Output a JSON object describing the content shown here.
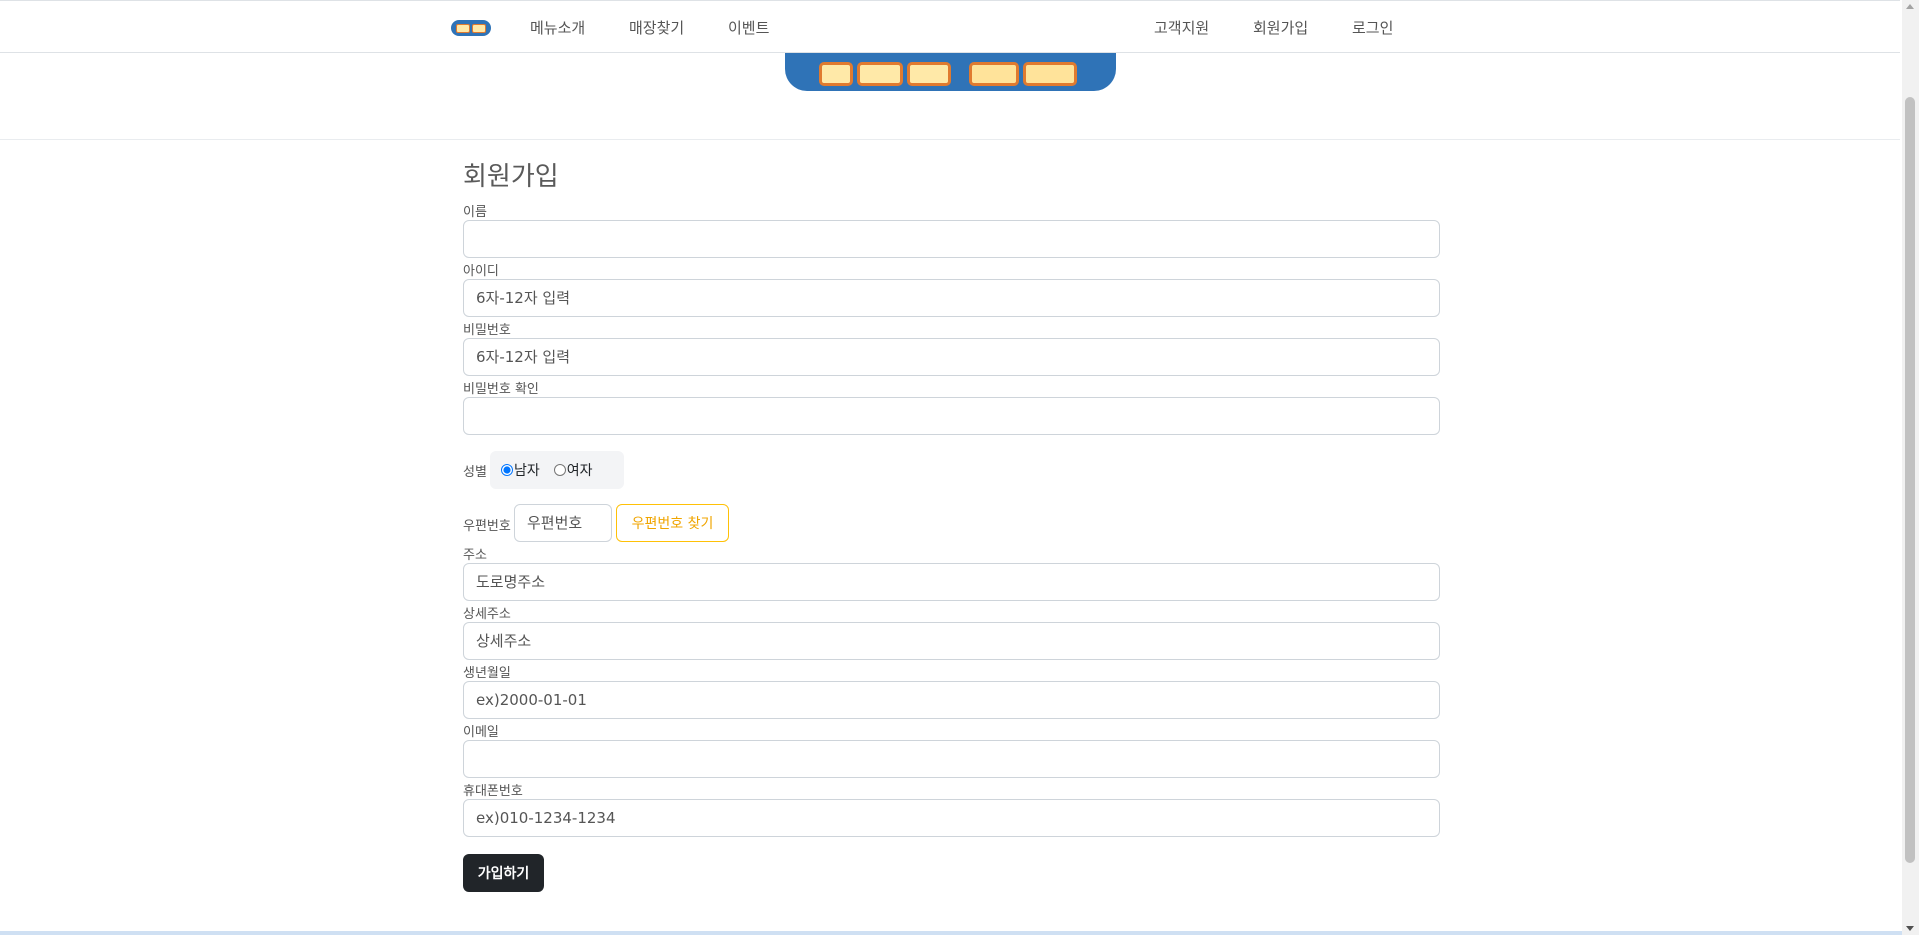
{
  "nav": {
    "left": [
      "메뉴소개",
      "매장찾기",
      "이벤트"
    ],
    "right": [
      "고객지원",
      "회원가입",
      "로그인"
    ]
  },
  "form": {
    "title": "회원가입",
    "name_label": "이름",
    "id_label": "아이디",
    "id_placeholder": "6자-12자 입력",
    "pw_label": "비밀번호",
    "pw_placeholder": "6자-12자 입력",
    "pw_confirm_label": "비밀번호 확인",
    "gender_label": "성별",
    "gender_options": [
      "남자",
      "여자"
    ],
    "gender_selected": "남자",
    "zip_label": "우편번호",
    "zip_placeholder": "우편번호",
    "zip_button": "우편번호 찾기",
    "address_label": "주소",
    "address_placeholder": "도로명주소",
    "address_detail_label": "상세주소",
    "address_detail_placeholder": "상세주소",
    "birth_label": "생년월일",
    "birth_placeholder": "ex)2000-01-01",
    "email_label": "이메일",
    "phone_label": "휴대폰번호",
    "phone_placeholder": "ex)010-1234-1234",
    "submit": "가입하기"
  },
  "colors": {
    "brand_blue": "#2f73b7",
    "accent_yellow": "#ffc107",
    "dark_button": "#212529"
  }
}
